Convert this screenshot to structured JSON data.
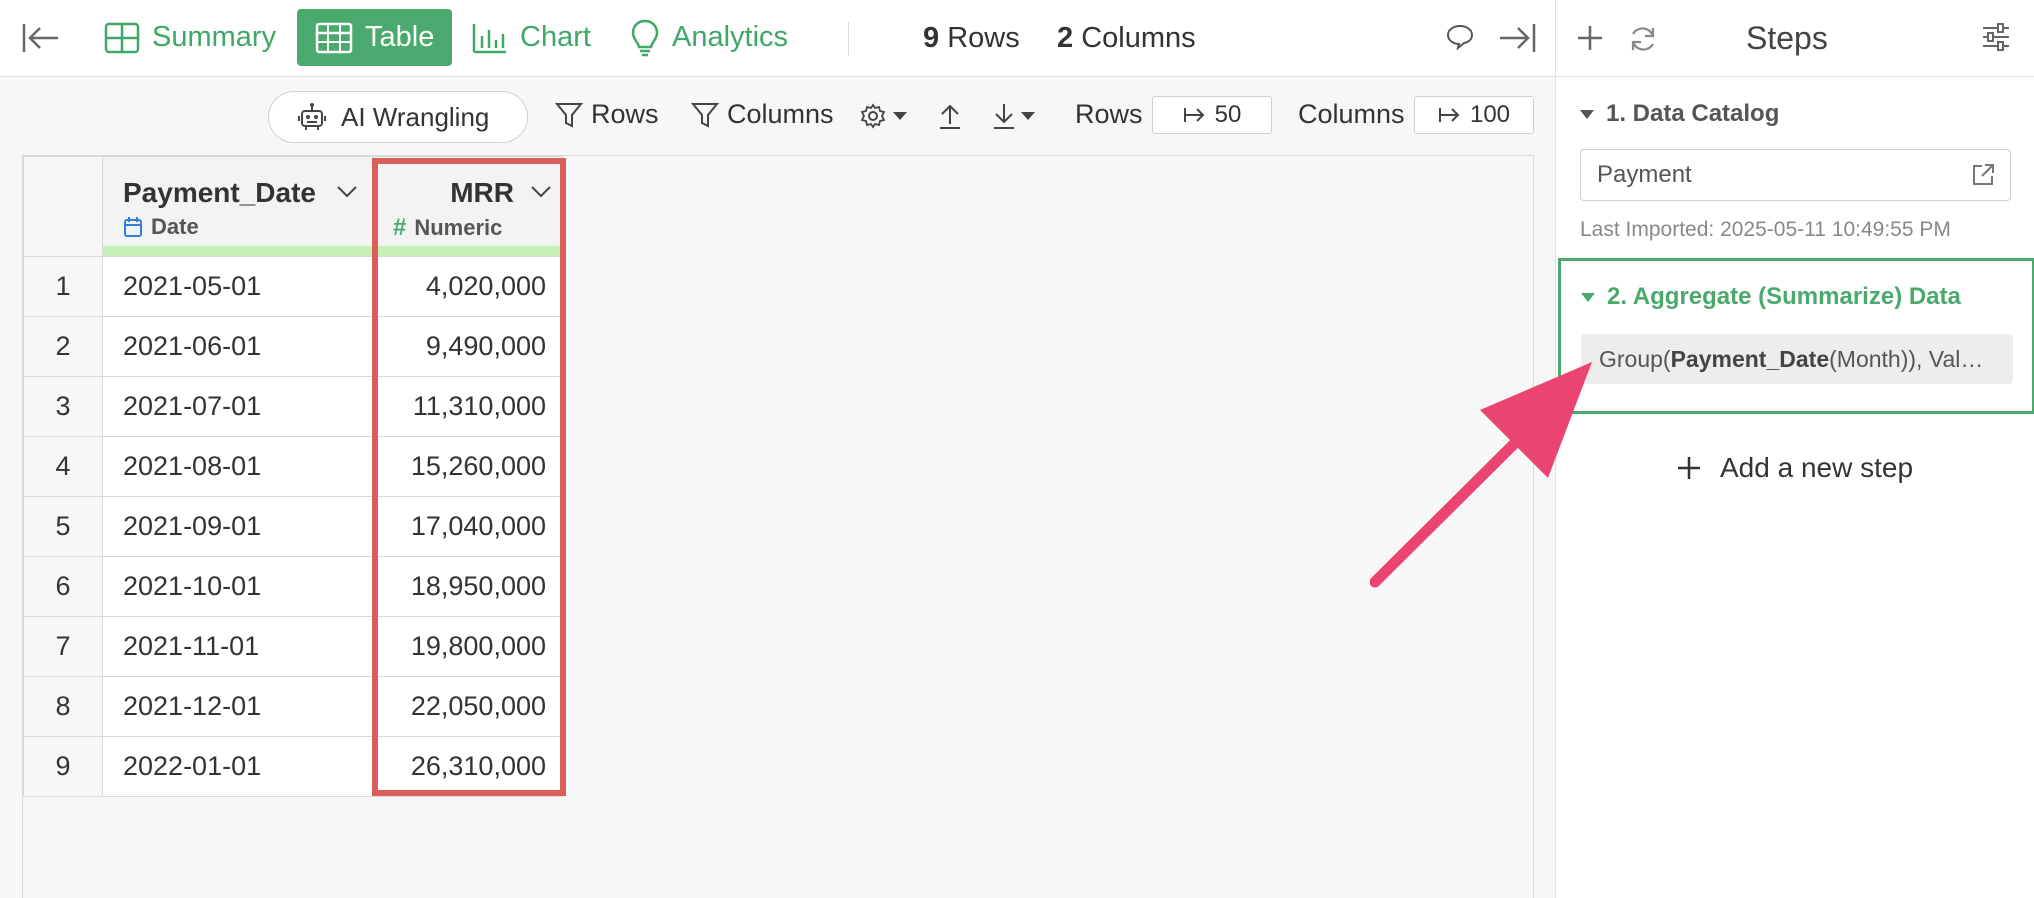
{
  "toolbar": {
    "tabs": [
      {
        "label": "Summary",
        "icon": "summary-grid-icon"
      },
      {
        "label": "Table",
        "icon": "table-icon",
        "active": true
      },
      {
        "label": "Chart",
        "icon": "bar-chart-icon"
      },
      {
        "label": "Analytics",
        "icon": "lightbulb-icon"
      }
    ],
    "rows_count": "9",
    "rows_label": "Rows",
    "columns_count": "2",
    "columns_label": "Columns"
  },
  "subtoolbar": {
    "ai_label": "AI Wrangling",
    "rows_filter": "Rows",
    "columns_filter": "Columns",
    "rows_label": "Rows",
    "rows_value": "50",
    "columns_label": "Columns",
    "columns_value": "100"
  },
  "table": {
    "columns": [
      {
        "name": "Payment_Date",
        "type": "Date"
      },
      {
        "name": "MRR",
        "type": "Numeric"
      }
    ],
    "rows": [
      {
        "idx": "1",
        "date": "2021-05-01",
        "mrr": "4,020,000"
      },
      {
        "idx": "2",
        "date": "2021-06-01",
        "mrr": "9,490,000"
      },
      {
        "idx": "3",
        "date": "2021-07-01",
        "mrr": "11,310,000"
      },
      {
        "idx": "4",
        "date": "2021-08-01",
        "mrr": "15,260,000"
      },
      {
        "idx": "5",
        "date": "2021-09-01",
        "mrr": "17,040,000"
      },
      {
        "idx": "6",
        "date": "2021-10-01",
        "mrr": "18,950,000"
      },
      {
        "idx": "7",
        "date": "2021-11-01",
        "mrr": "19,800,000"
      },
      {
        "idx": "8",
        "date": "2021-12-01",
        "mrr": "22,050,000"
      },
      {
        "idx": "9",
        "date": "2022-01-01",
        "mrr": "26,310,000"
      }
    ]
  },
  "steps": {
    "title": "Steps",
    "step1": {
      "title": "1. Data Catalog",
      "source": "Payment",
      "imported": "Last Imported: 2025-05-11 10:49:55 PM"
    },
    "step2": {
      "title": "2. Aggregate (Summarize) Data",
      "chip_prefix": "Group(",
      "chip_bold": "Payment_Date",
      "chip_suffix": " (Month)), Val…"
    },
    "add_step": "Add a new step"
  },
  "colors": {
    "accent": "#4aa96c",
    "highlight": "#d95f5a",
    "arrow": "#ec4470",
    "date_icon": "#2f7fd9"
  }
}
